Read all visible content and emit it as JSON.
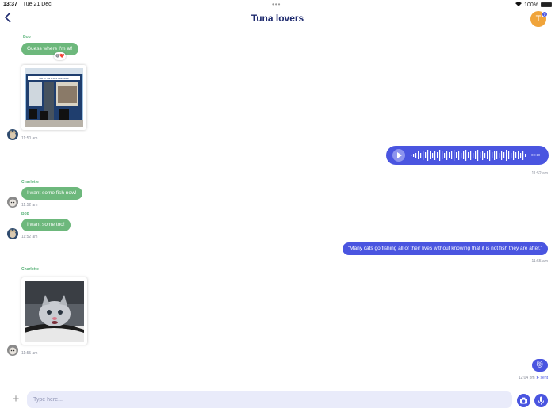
{
  "status_bar": {
    "time": "13:37",
    "date": "Tue 21 Dec",
    "battery": "100%"
  },
  "header": {
    "title": "Tuna lovers",
    "avatar_letter": "T",
    "badge_count": "9"
  },
  "messages": {
    "m1": {
      "sender": "Bob",
      "text": "Guess where I'm at!",
      "reactions": "😄❤️"
    },
    "m2": {
      "time": "11:50 am",
      "shop_sign": "THE LITTLE FISH & CHIP SHOP"
    },
    "m3": {
      "duration": "00:10",
      "time": "11:52 am"
    },
    "m4": {
      "sender": "Charlotte",
      "text": "I want some fish now!",
      "time": "11:52 am"
    },
    "m5": {
      "sender": "Bob",
      "text": "I want some too!",
      "time": "11:52 am"
    },
    "m6": {
      "text": "\"Many cats go fishing all of their lives without knowing that it is not fish they are after.\"",
      "time": "11:55 am"
    },
    "m7": {
      "sender": "Charlotte",
      "time": "11:55 am"
    },
    "m8": {
      "emoji": "😻",
      "time": "12:04 pm",
      "status": "sent"
    }
  },
  "composer": {
    "placeholder": "Type here..."
  },
  "colors": {
    "accent": "#4a55e0",
    "incoming": "#6db87c",
    "title": "#1e2a6e"
  }
}
